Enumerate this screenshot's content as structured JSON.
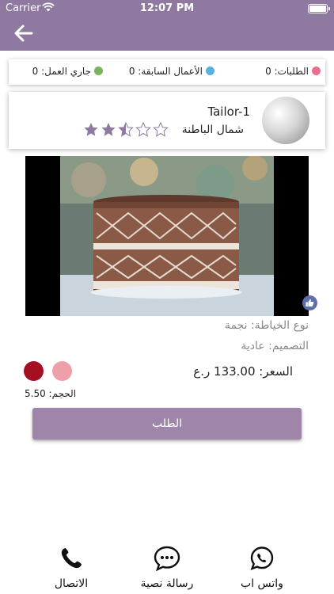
{
  "status_bar": {
    "carrier": "Carrier",
    "time": "12:07 PM"
  },
  "stats": {
    "orders": "الطلبات: 0",
    "past_works": "الأعمال السابقة: 0",
    "current_work": "جاري العمل: 0"
  },
  "tailor": {
    "name": "Tailor-1",
    "region": "شمال الباطنة",
    "rating": 2.5,
    "rating_max": 5
  },
  "product": {
    "sewing_type": "نوع الخياطة: نجمة",
    "design": "التصميم: عادية",
    "price": "السعر: 133.00 ر.ع",
    "size": "الحجم: 5.50",
    "colors": [
      "#a50f22",
      "#eea0aa"
    ]
  },
  "order_button": "الطلب",
  "contact": {
    "call": "الاتصال",
    "sms": "رسالة نصية",
    "whatsapp": "واتس اب"
  },
  "icons": [
    "back-arrow-icon",
    "wifi-icon",
    "battery-icon",
    "like-icon",
    "phone-icon",
    "sms-icon",
    "whatsapp-icon"
  ],
  "theme": {
    "header": "#8f79a1",
    "button": "#9f85aa",
    "star": "#8f79a1"
  }
}
